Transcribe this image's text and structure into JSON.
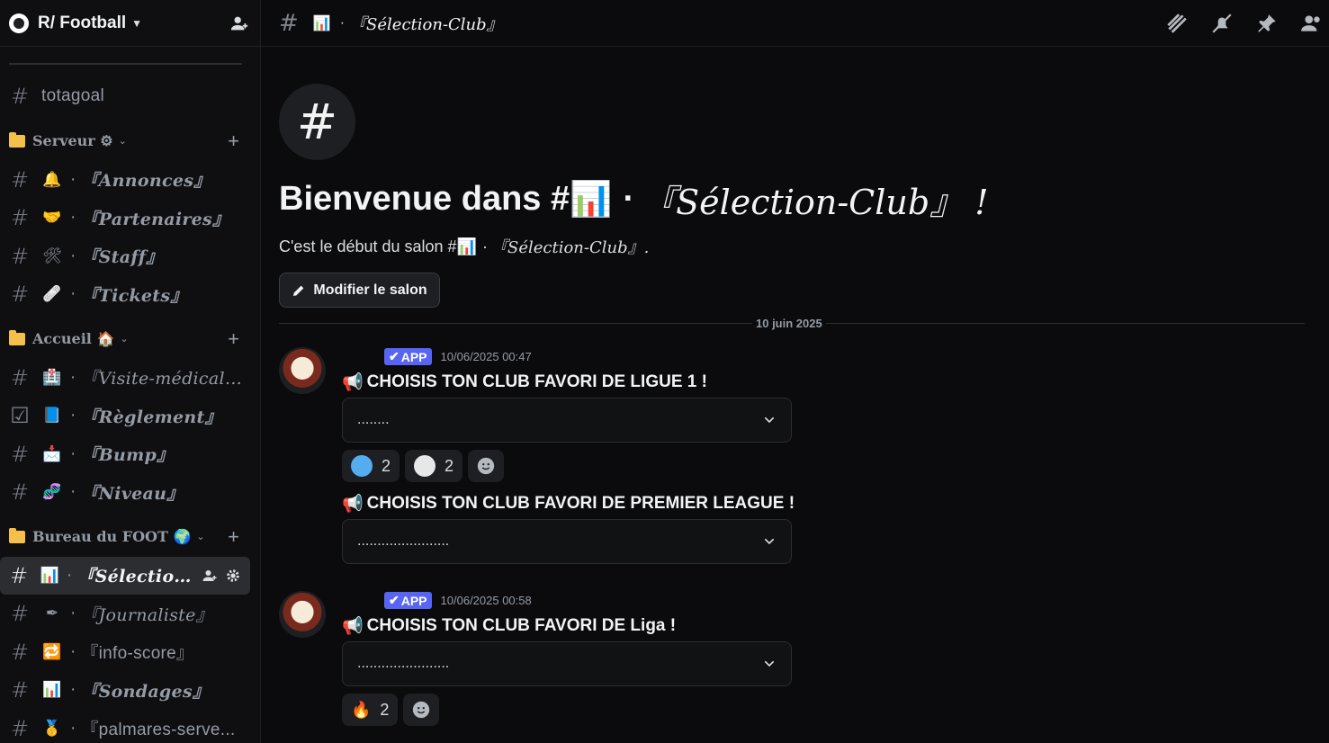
{
  "server": {
    "name": "R/ Football"
  },
  "sidebar": {
    "top_channel": {
      "label": "totagoal"
    },
    "categories": [
      {
        "name": "Serveur ⚙",
        "channels": [
          {
            "emoji": "🔔",
            "label": "『Annonces』"
          },
          {
            "emoji": "🤝",
            "label": "『Partenaires』"
          },
          {
            "emoji": "🛠",
            "label": "『Staff』"
          },
          {
            "emoji": "🩹",
            "label": "『Tickets』"
          }
        ]
      },
      {
        "name": "Accueil 🏠",
        "channels": [
          {
            "emoji": "🏥",
            "label": "『Visite-médicale..."
          },
          {
            "emoji": "📘",
            "label": "『Règlement』"
          },
          {
            "emoji": "📩",
            "label": "『Bump』"
          },
          {
            "emoji": "🧬",
            "label": "『Niveau』"
          }
        ]
      },
      {
        "name": "Bureau du FOOT 🌍",
        "channels": [
          {
            "emoji": "📊",
            "label": "『Sélection-..."
          },
          {
            "emoji": "✒",
            "label": "『Journaliste』"
          },
          {
            "emoji": "🔁",
            "label": "『info-score』"
          },
          {
            "emoji": "📊",
            "label": "『Sondages』"
          },
          {
            "emoji": "🥇",
            "label": "『palmares-serve..."
          }
        ]
      }
    ]
  },
  "topbar": {
    "title": "『Sélection-Club』",
    "emoji": "📊"
  },
  "welcome": {
    "title_prefix": "Bienvenue dans #",
    "title_channel": "『Sélection-Club』 !",
    "subtitle_prefix": "C'est le début du salon #",
    "subtitle_channel": "『Sélection-Club』.",
    "edit_button": "Modifier le salon"
  },
  "divider_date": "10 juin 2025",
  "messages": [
    {
      "badge": "APP",
      "timestamp": "10/06/2025 00:47",
      "blocks": [
        {
          "headline": "CHOISIS TON CLUB FAVORI DE LIGUE 1 !",
          "select_value": "........",
          "reactions": [
            {
              "emoji": "blue-circle",
              "count": "2"
            },
            {
              "emoji": "white-circle",
              "count": "2"
            }
          ]
        },
        {
          "headline": "CHOISIS TON CLUB FAVORI DE PREMIER LEAGUE !",
          "select_value": "......................."
        }
      ]
    },
    {
      "badge": "APP",
      "timestamp": "10/06/2025 00:58",
      "blocks": [
        {
          "headline": "CHOISIS TON CLUB FAVORI DE Liga !",
          "select_value": ".......................",
          "reactions": [
            {
              "emoji": "🔥",
              "count": "2"
            }
          ]
        }
      ]
    }
  ],
  "colors": {
    "accent": "#5865f2",
    "folder": "#f5c04a",
    "blue_circle": "#55acee",
    "white_circle": "#e6e7e8"
  }
}
